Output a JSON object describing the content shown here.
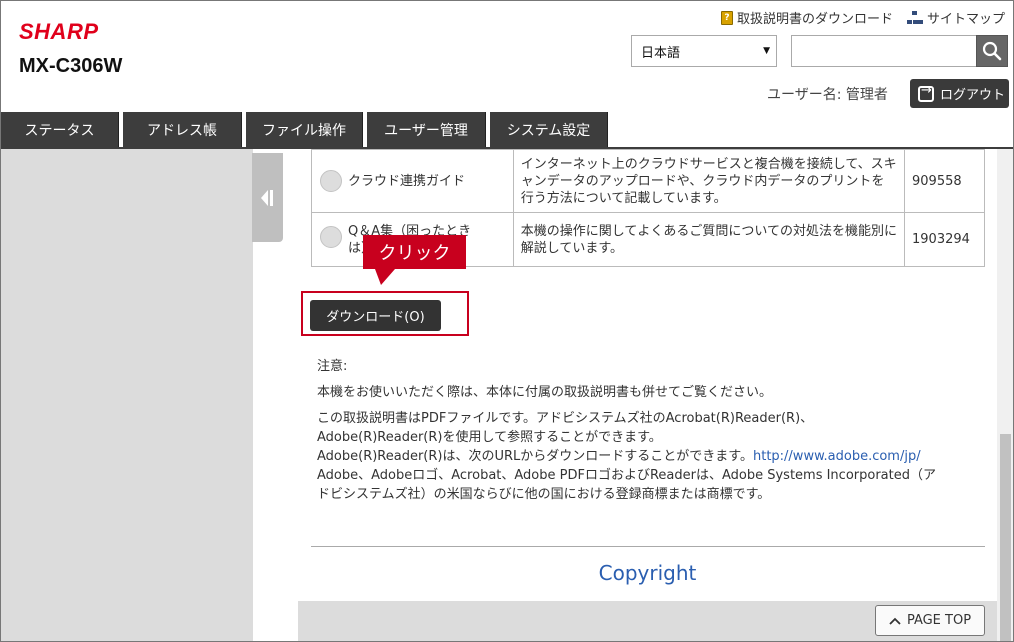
{
  "header": {
    "brand": "SHARP",
    "model": "MX-C306W",
    "links": {
      "manual_download": "取扱説明書のダウンロード",
      "sitemap": "サイトマップ"
    },
    "language": "日本語",
    "search_value": "",
    "user_label": "ユーザー名: 管理者",
    "logout_label": "ログアウト"
  },
  "nav": {
    "tabs": [
      {
        "label": "ステータス"
      },
      {
        "label": "アドレス帳"
      },
      {
        "label": "ファイル操作"
      },
      {
        "label": "ユーザー管理"
      },
      {
        "label": "システム設定"
      }
    ]
  },
  "guides": {
    "rows": [
      {
        "name": "クラウド連携ガイド",
        "desc": "インターネット上のクラウドサービスと複合機を接続して、スキャンデータのアップロードや、クラウド内データのプリントを行う方法について記載しています。",
        "size": "909558"
      },
      {
        "name": "Q＆A集（困ったときは）",
        "desc": "本機の操作に関してよくあるご質問についての対処法を機能別に解説しています。",
        "size": "1903294"
      }
    ]
  },
  "callout": "クリック",
  "download_button": "ダウンロード(O)",
  "notes": {
    "heading": "注意:",
    "line1": "本機をお使いいただく際は、本体に付属の取扱説明書も併せてご覧ください。",
    "line2a": "この取扱説明書はPDFファイルです。アドビシステムズ社のAcrobat(R)Reader(R)、",
    "line2b": "Adobe(R)Reader(R)を使用して参照することができます。",
    "line3": "Adobe(R)Reader(R)は、次のURLからダウンロードすることができます。",
    "url": "http://www.adobe.com/jp/",
    "line4a": "Adobe、Adobeロゴ、Acrobat、Adobe PDFロゴおよびReaderは、Adobe Systems Incorporated（ア",
    "line4b": "ドビシステムズ社）の米国ならびに他の国における登録商標または商標です。"
  },
  "footer": {
    "copyright": "Copyright",
    "page_top": "PAGE TOP"
  },
  "icons": {
    "search": "search-icon",
    "logout": "logout-icon",
    "manual": "manual-icon",
    "sitemap": "sitemap-icon",
    "collapse": "collapse-sidebar-icon"
  },
  "colors": {
    "brand_red": "#e0001b",
    "nav_dark": "#3d3d3d",
    "link_blue": "#2a5eb0",
    "callout_red": "#c8001e"
  }
}
